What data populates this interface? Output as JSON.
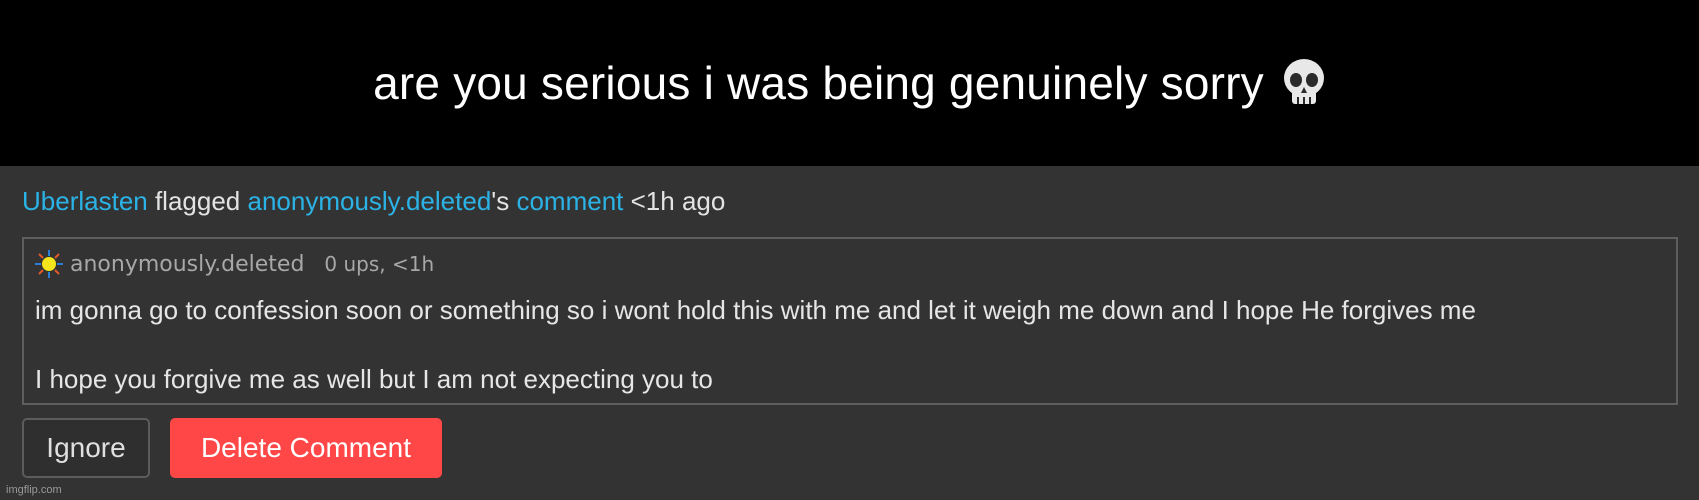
{
  "caption": {
    "text": "are you serious i was being genuinely sorry",
    "icon": "skull-icon"
  },
  "notification": {
    "flagger": "Uberlasten",
    "action": " flagged ",
    "target_user": "anonymously.deleted",
    "possessive": "'s ",
    "target_type": "comment",
    "time": " <1h ago"
  },
  "comment": {
    "avatar_icon": "sun-icon",
    "author": "anonymously.deleted",
    "stats": "0 ups, <1h",
    "lines": [
      "im gonna go to confession soon or something so i wont hold this with me and let it weigh me down and I hope He forgives me",
      "I hope you forgive me as well but I am not expecting you to"
    ]
  },
  "actions": {
    "ignore_label": "Ignore",
    "delete_label": "Delete Comment"
  },
  "watermark": "imgflip.com",
  "colors": {
    "link": "#2bb3e6",
    "delete_button": "#ff4747",
    "panel_background": "#333333",
    "caption_background": "#000000"
  }
}
